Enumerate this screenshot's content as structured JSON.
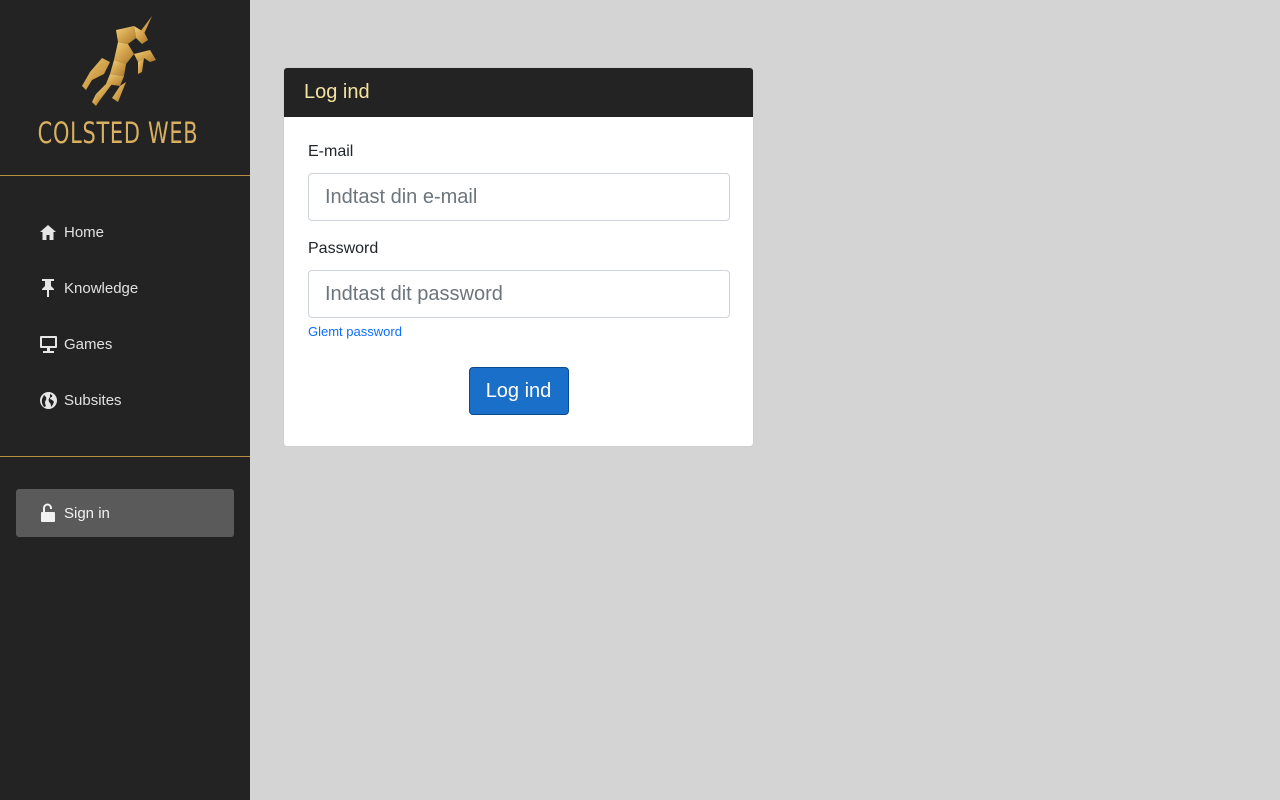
{
  "brand": {
    "name": "COLSTED WEB",
    "logo_icon": "unicorn-icon",
    "accent_color": "#d9b060"
  },
  "sidebar": {
    "items": [
      {
        "label": "Home",
        "icon": "home-icon"
      },
      {
        "label": "Knowledge",
        "icon": "pin-icon"
      },
      {
        "label": "Games",
        "icon": "monitor-icon"
      },
      {
        "label": "Subsites",
        "icon": "globe-icon"
      }
    ],
    "signin": {
      "label": "Sign in",
      "icon": "unlock-icon"
    }
  },
  "login": {
    "title": "Log ind",
    "email_label": "E-mail",
    "email_placeholder": "Indtast din e-mail",
    "email_value": "",
    "password_label": "Password",
    "password_placeholder": "Indtast dit password",
    "password_value": "",
    "forgot_label": "Glemt password",
    "submit_label": "Log ind"
  },
  "colors": {
    "sidebar_bg": "#232323",
    "page_bg": "#d4d4d4",
    "header_text": "#f3e3a0",
    "button_bg": "#1a6fc8",
    "link": "#0d6efd"
  }
}
